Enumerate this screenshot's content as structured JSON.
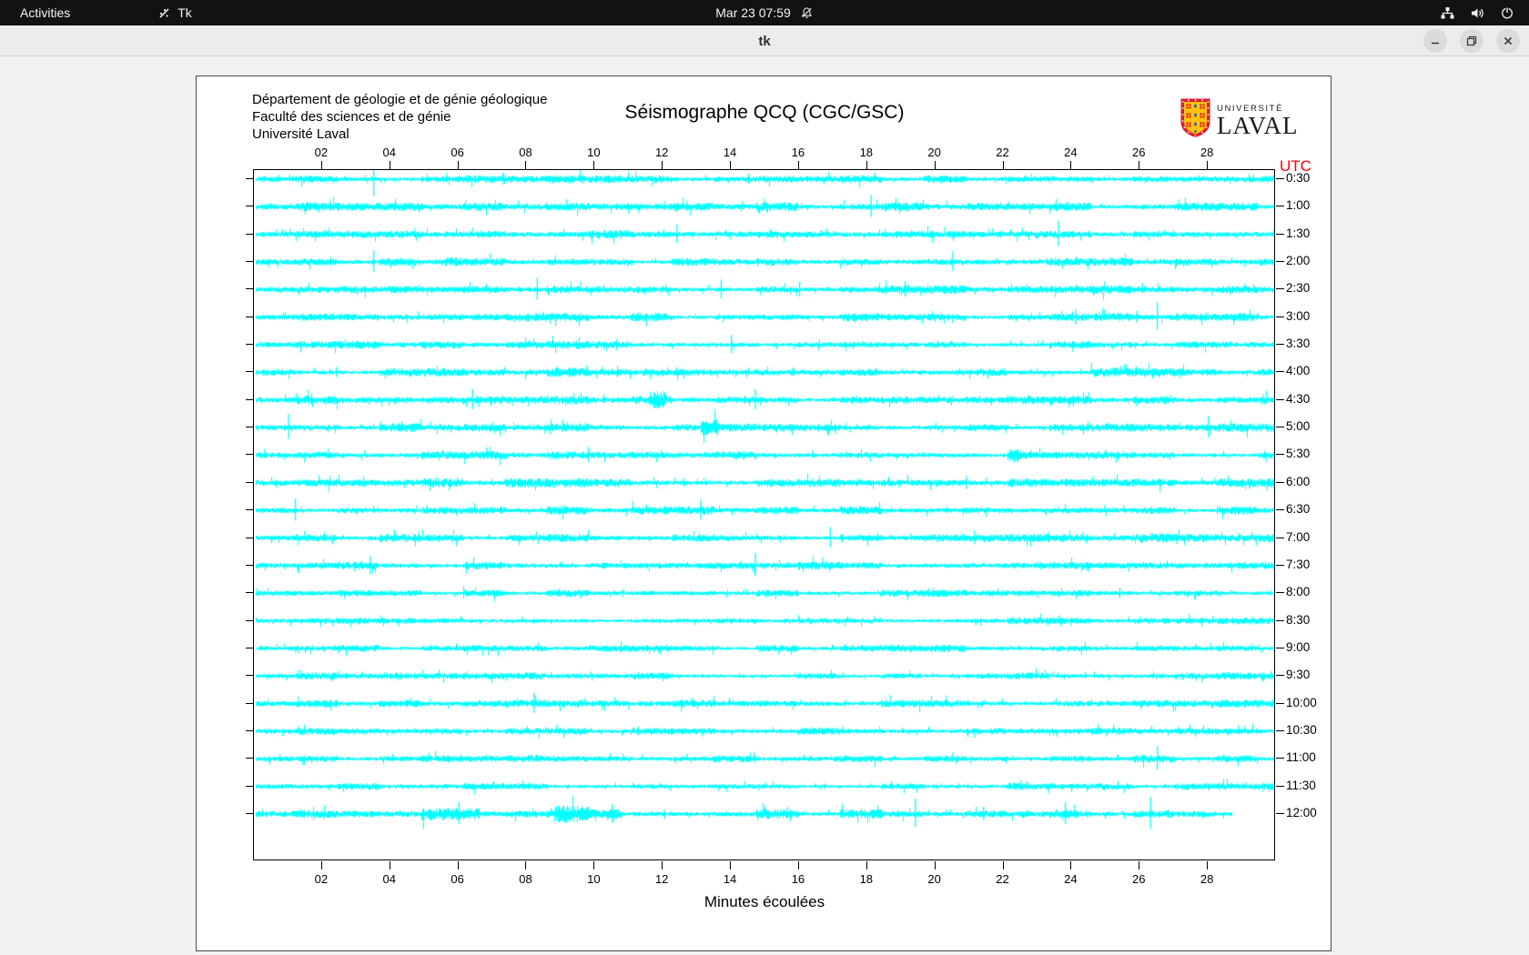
{
  "top_bar": {
    "activities_label": "Activities",
    "app_indicator_label": "Tk",
    "clock": "Mar 23 07:59",
    "icons": [
      "notifications-muted",
      "network-wired",
      "volume",
      "power"
    ]
  },
  "title_bar": {
    "title": "tk",
    "buttons": [
      "minimize",
      "maximize",
      "close"
    ]
  },
  "seismograph": {
    "header_lines": [
      "Département de géologie et de génie géologique",
      "Faculté des sciences et de génie",
      "Université Laval"
    ],
    "title": "Séismographe QCQ (CGC/GSC)",
    "logo": {
      "line1": "UNIVERSITÉ",
      "line2": "LAVAL"
    },
    "utc_label": "UTC",
    "xlabel": "Minutes écoulées",
    "colors": {
      "trace": "#00ffff",
      "utc_text": "#ff0000",
      "logo_red": "#e01b2c",
      "logo_gold": "#ffc20e",
      "logo_blue": "#1867c0"
    }
  },
  "chart_data": {
    "type": "line",
    "title": "Séismographe QCQ (CGC/GSC)",
    "xlabel": "Minutes écoulées",
    "ylabel": "UTC",
    "x_range": [
      0,
      30
    ],
    "x_tick_minutes": [
      2,
      4,
      6,
      8,
      10,
      12,
      14,
      16,
      18,
      20,
      22,
      24,
      26,
      28
    ],
    "x_tick_labels": [
      "02",
      "04",
      "06",
      "08",
      "10",
      "12",
      "14",
      "16",
      "18",
      "20",
      "22",
      "24",
      "26",
      "28"
    ],
    "grid": false,
    "legend": "none",
    "trace_color": "#00ffff",
    "rows": [
      {
        "label": "0:30",
        "amp": 2.0,
        "spikes": [
          [
            3.5,
            22
          ],
          [
            7.3,
            7
          ],
          [
            14.5,
            6
          ]
        ],
        "bursts": [],
        "end": 30
      },
      {
        "label": "1:00",
        "amp": 2.2,
        "spikes": [
          [
            18.1,
            13
          ]
        ],
        "bursts": [],
        "end": 30
      },
      {
        "label": "1:30",
        "amp": 2.0,
        "spikes": [
          [
            12.4,
            11
          ],
          [
            23.6,
            15
          ]
        ],
        "bursts": [],
        "end": 30
      },
      {
        "label": "2:00",
        "amp": 2.1,
        "spikes": [
          [
            3.5,
            13
          ],
          [
            20.5,
            12
          ]
        ],
        "bursts": [
          [
            5.6,
            6.1,
            2.0
          ]
        ],
        "end": 30
      },
      {
        "label": "2:30",
        "amp": 2.1,
        "spikes": [
          [
            8.3,
            13
          ],
          [
            13.7,
            11
          ],
          [
            16.0,
            9
          ],
          [
            19.1,
            9
          ]
        ],
        "bursts": [],
        "end": 30
      },
      {
        "label": "3:00",
        "amp": 2.0,
        "spikes": [
          [
            24.1,
            9
          ],
          [
            25.9,
            7
          ],
          [
            26.5,
            16
          ]
        ],
        "bursts": [],
        "end": 30
      },
      {
        "label": "3:30",
        "amp": 2.0,
        "spikes": [
          [
            14.0,
            11
          ]
        ],
        "bursts": [],
        "end": 30
      },
      {
        "label": "4:00",
        "amp": 2.3,
        "spikes": [
          [
            2.4,
            6
          ],
          [
            15.8,
            5
          ]
        ],
        "bursts": [],
        "end": 30
      },
      {
        "label": "4:30",
        "amp": 2.1,
        "spikes": [
          [
            6.4,
            12
          ],
          [
            14.7,
            12
          ]
        ],
        "bursts": [
          [
            11.6,
            12.1,
            2.2
          ]
        ],
        "end": 30
      },
      {
        "label": "5:00",
        "amp": 2.1,
        "spikes": [
          [
            1.0,
            15
          ],
          [
            28.0,
            13
          ]
        ],
        "bursts": [
          [
            13.1,
            13.6,
            2.2
          ]
        ],
        "end": 30
      },
      {
        "label": "5:30",
        "amp": 2.0,
        "spikes": [
          [
            9.8,
            9
          ]
        ],
        "bursts": [
          [
            22.1,
            22.5,
            1.8
          ]
        ],
        "end": 30
      },
      {
        "label": "6:00",
        "amp": 2.2,
        "spikes": [
          [
            12.6,
            5
          ],
          [
            20.9,
            8
          ]
        ],
        "bursts": [],
        "end": 30
      },
      {
        "label": "6:30",
        "amp": 2.0,
        "spikes": [
          [
            1.2,
            13
          ],
          [
            13.1,
            12
          ]
        ],
        "bursts": [],
        "end": 30
      },
      {
        "label": "7:00",
        "amp": 2.0,
        "spikes": [
          [
            16.9,
            12
          ]
        ],
        "bursts": [],
        "end": 30
      },
      {
        "label": "7:30",
        "amp": 2.0,
        "spikes": [
          [
            3.4,
            11
          ],
          [
            14.7,
            14
          ]
        ],
        "bursts": [],
        "end": 30
      },
      {
        "label": "8:00",
        "amp": 1.9,
        "spikes": [
          [
            25.4,
            6
          ]
        ],
        "bursts": [],
        "end": 30
      },
      {
        "label": "8:30",
        "amp": 1.7,
        "spikes": [],
        "bursts": [],
        "end": 30
      },
      {
        "label": "9:00",
        "amp": 1.7,
        "spikes": [],
        "bursts": [],
        "end": 30
      },
      {
        "label": "9:30",
        "amp": 1.7,
        "spikes": [],
        "bursts": [],
        "end": 30
      },
      {
        "label": "10:00",
        "amp": 1.9,
        "spikes": [
          [
            8.2,
            12
          ]
        ],
        "bursts": [],
        "end": 30
      },
      {
        "label": "10:30",
        "amp": 1.8,
        "spikes": [],
        "bursts": [],
        "end": 30
      },
      {
        "label": "11:00",
        "amp": 1.9,
        "spikes": [
          [
            26.5,
            14
          ]
        ],
        "bursts": [],
        "end": 30
      },
      {
        "label": "11:30",
        "amp": 1.8,
        "spikes": [],
        "bursts": [],
        "end": 30
      },
      {
        "label": "12:00",
        "amp": 2.3,
        "spikes": [
          [
            6.0,
            13
          ],
          [
            10.5,
            11
          ],
          [
            19.4,
            17
          ],
          [
            21.4,
            8
          ],
          [
            23.8,
            13
          ],
          [
            26.3,
            19
          ]
        ],
        "bursts": [
          [
            4.9,
            6.6,
            2.2
          ],
          [
            8.8,
            10.8,
            2.0
          ]
        ],
        "end": 28.7
      }
    ]
  }
}
